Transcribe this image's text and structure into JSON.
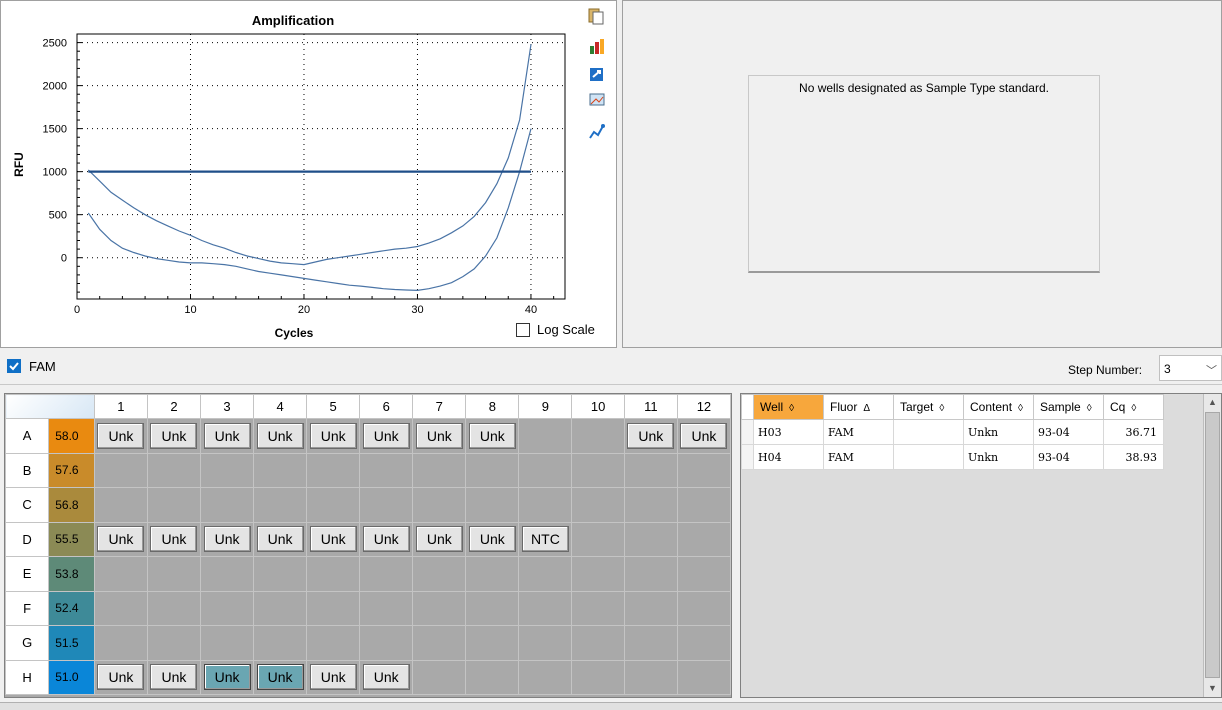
{
  "chart_data": {
    "type": "line",
    "title": "Amplification",
    "xlabel": "Cycles",
    "ylabel": "RFU",
    "xlim": [
      0,
      43
    ],
    "ylim": [
      -480,
      2600
    ],
    "xticks": [
      0,
      10,
      20,
      30,
      40
    ],
    "yticks": [
      0,
      500,
      1000,
      1500,
      2000,
      2500
    ],
    "grid": "dotted",
    "threshold": 1000,
    "series": [
      {
        "x": [
          1,
          2,
          3,
          4,
          5,
          6,
          7,
          8,
          9,
          10,
          11,
          12,
          13,
          14,
          15,
          16,
          17,
          18,
          19,
          20,
          21,
          22,
          23,
          24,
          25,
          26,
          27,
          28,
          29,
          30,
          31,
          32,
          33,
          34,
          35,
          36,
          37,
          38,
          39,
          40
        ],
        "values": [
          1020,
          890,
          760,
          670,
          580,
          500,
          430,
          370,
          310,
          260,
          200,
          150,
          110,
          60,
          20,
          -10,
          -40,
          -60,
          -70,
          -80,
          -50,
          -20,
          0,
          20,
          40,
          60,
          80,
          100,
          110,
          130,
          170,
          220,
          290,
          370,
          480,
          640,
          860,
          1160,
          1600,
          2480
        ]
      },
      {
        "x": [
          1,
          2,
          3,
          4,
          5,
          6,
          7,
          8,
          9,
          10,
          11,
          12,
          13,
          14,
          15,
          16,
          17,
          18,
          19,
          20,
          21,
          22,
          23,
          24,
          25,
          26,
          27,
          28,
          29,
          30,
          31,
          32,
          33,
          34,
          35,
          36,
          37,
          38,
          39,
          40
        ],
        "values": [
          520,
          330,
          200,
          110,
          60,
          20,
          -10,
          -30,
          -50,
          -60,
          -60,
          -70,
          -80,
          -100,
          -130,
          -160,
          -180,
          -200,
          -220,
          -240,
          -260,
          -280,
          -300,
          -320,
          -330,
          -345,
          -360,
          -370,
          -375,
          -380,
          -360,
          -330,
          -290,
          -220,
          -130,
          20,
          230,
          580,
          1000,
          1500
        ]
      }
    ]
  },
  "chart_ui": {
    "log_scale_label": "Log Scale",
    "log_scale_checked": false,
    "icons": [
      "copy-icon",
      "chart-settings-icon",
      "export-icon",
      "image-icon",
      "series-icon"
    ]
  },
  "standard_curve": {
    "message": "No wells designated as Sample Type standard."
  },
  "filter": {
    "fluor_label": "FAM",
    "fluor_checked": true,
    "step_label": "Step Number:",
    "step_value": "3"
  },
  "plate": {
    "columns": [
      "1",
      "2",
      "3",
      "4",
      "5",
      "6",
      "7",
      "8",
      "9",
      "10",
      "11",
      "12"
    ],
    "rows": [
      {
        "label": "A",
        "temp": "58.0",
        "temp_color": "#e98a10",
        "wells": [
          "Unk",
          "Unk",
          "Unk",
          "Unk",
          "Unk",
          "Unk",
          "Unk",
          "Unk",
          "",
          "",
          "Unk",
          "Unk"
        ],
        "selected": []
      },
      {
        "label": "B",
        "temp": "57.6",
        "temp_color": "#c98b2a",
        "wells": [
          "",
          "",
          "",
          "",
          "",
          "",
          "",
          "",
          "",
          "",
          "",
          ""
        ],
        "selected": []
      },
      {
        "label": "C",
        "temp": "56.8",
        "temp_color": "#aa8a3c",
        "wells": [
          "",
          "",
          "",
          "",
          "",
          "",
          "",
          "",
          "",
          "",
          "",
          ""
        ],
        "selected": []
      },
      {
        "label": "D",
        "temp": "55.5",
        "temp_color": "#8b8a55",
        "wells": [
          "Unk",
          "Unk",
          "Unk",
          "Unk",
          "Unk",
          "Unk",
          "Unk",
          "Unk",
          "NTC",
          "",
          "",
          ""
        ],
        "selected": []
      },
      {
        "label": "E",
        "temp": "53.8",
        "temp_color": "#5e8a78",
        "wells": [
          "",
          "",
          "",
          "",
          "",
          "",
          "",
          "",
          "",
          "",
          "",
          ""
        ],
        "selected": []
      },
      {
        "label": "F",
        "temp": "52.4",
        "temp_color": "#3e8a98",
        "wells": [
          "",
          "",
          "",
          "",
          "",
          "",
          "",
          "",
          "",
          "",
          "",
          ""
        ],
        "selected": []
      },
      {
        "label": "G",
        "temp": "51.5",
        "temp_color": "#1f88b8",
        "wells": [
          "",
          "",
          "",
          "",
          "",
          "",
          "",
          "",
          "",
          "",
          "",
          ""
        ],
        "selected": []
      },
      {
        "label": "H",
        "temp": "51.0",
        "temp_color": "#0a86d8",
        "wells": [
          "Unk",
          "Unk",
          "Unk",
          "Unk",
          "Unk",
          "Unk",
          "",
          "",
          "",
          "",
          "",
          ""
        ],
        "selected": [
          2,
          3
        ]
      }
    ]
  },
  "data_grid": {
    "headers": [
      {
        "label": "Well",
        "glyph": "◊",
        "sorted": true
      },
      {
        "label": "Fluor",
        "glyph": "Δ",
        "sorted": false
      },
      {
        "label": "Target",
        "glyph": "◊",
        "sorted": false
      },
      {
        "label": "Content",
        "glyph": "◊",
        "sorted": false
      },
      {
        "label": "Sample",
        "glyph": "◊",
        "sorted": false
      },
      {
        "label": "Cq",
        "glyph": "◊",
        "sorted": false
      }
    ],
    "rows": [
      [
        "H03",
        "FAM",
        "",
        "Unkn",
        "93-04",
        "36.71"
      ],
      [
        "H04",
        "FAM",
        "",
        "Unkn",
        "93-04",
        "38.93"
      ]
    ]
  }
}
